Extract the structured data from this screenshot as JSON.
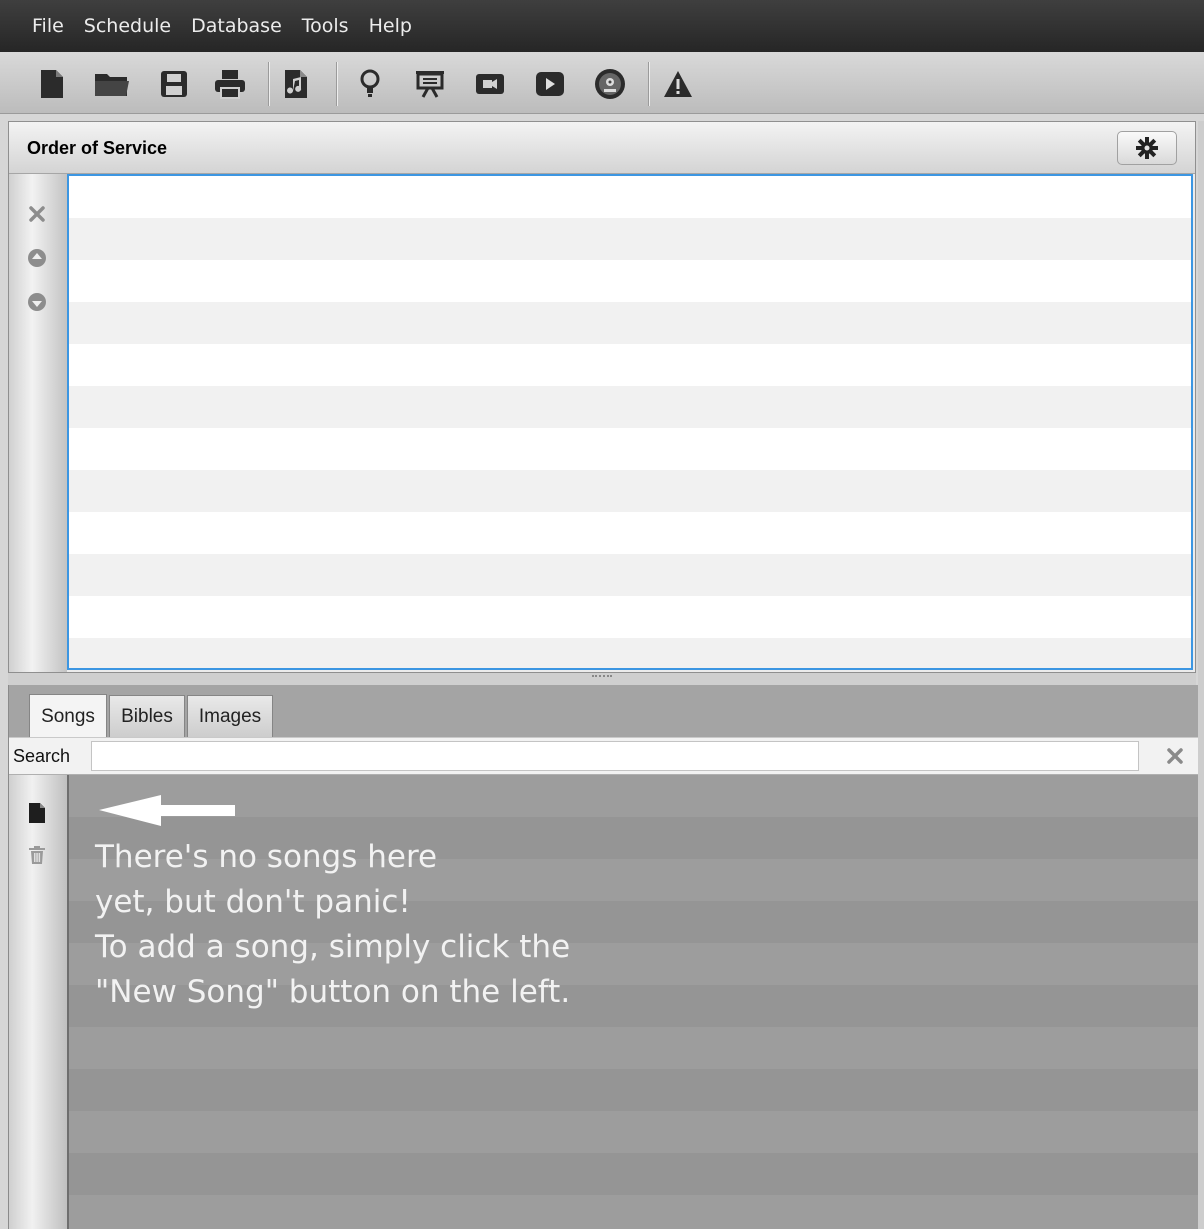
{
  "menu": [
    "File",
    "Schedule",
    "Database",
    "Tools",
    "Help"
  ],
  "toolbar": {
    "icons": [
      "new-schedule-icon",
      "open-schedule-icon",
      "save-schedule-icon",
      "print-icon",
      "new-song-icon",
      "notice-icon",
      "presentation-icon",
      "video-icon",
      "youtube-icon",
      "dvd-icon",
      "warning-icon"
    ]
  },
  "order_of_service": {
    "title": "Order of Service",
    "settings_icon": "gear-icon",
    "side_icons": [
      "remove-icon",
      "move-up-icon",
      "move-down-icon"
    ]
  },
  "library": {
    "tabs": [
      "Songs",
      "Bibles",
      "Images"
    ],
    "active_tab": "Songs",
    "search_label": "Search",
    "search_value": "",
    "clear_icon": "clear-search-icon",
    "side_icons": [
      "new-song-icon",
      "delete-song-icon"
    ],
    "empty_message": [
      "There's no songs here",
      "yet, but don't panic!",
      "To add a song, simply click the",
      "\"New Song\" button on the left."
    ]
  },
  "colors": {
    "menubar": "#2f2f2f",
    "selection_border": "#3c96e2",
    "library_background": "#9c9c9c"
  }
}
